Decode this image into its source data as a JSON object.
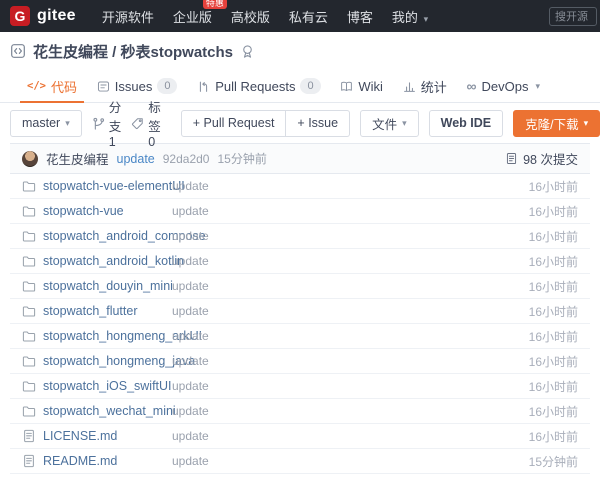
{
  "navbar": {
    "logo_letter": "G",
    "logo_text": "gitee",
    "items": [
      {
        "label": "开源软件"
      },
      {
        "label": "企业版",
        "badge": "特惠"
      },
      {
        "label": "高校版"
      },
      {
        "label": "私有云"
      },
      {
        "label": "博客"
      },
      {
        "label": "我的"
      }
    ],
    "search_placeholder": "搜开源"
  },
  "repo": {
    "title": "花生皮编程 / 秒表stopwatchs"
  },
  "tabs": [
    {
      "label": "代码",
      "active": true
    },
    {
      "label": "Issues",
      "count": "0"
    },
    {
      "label": "Pull Requests",
      "count": "0"
    },
    {
      "label": "Wiki"
    },
    {
      "label": "统计"
    },
    {
      "label": "DevOps"
    }
  ],
  "toolbar": {
    "branch_button": "master",
    "branches_text": "分支 1",
    "tags_text": "标签 0",
    "pull_request_button": "+ Pull Request",
    "issue_button": "+ Issue",
    "files_button": "文件",
    "web_ide_button": "Web IDE",
    "clone_button": "克隆/下载"
  },
  "commit_bar": {
    "author": "花生皮编程",
    "message": "update",
    "hash": "92da2d0",
    "time": "15分钟前",
    "commits_count": "98 次提交"
  },
  "files": [
    {
      "name": "stopwatch-vue-elementUI",
      "type": "folder",
      "message": "update",
      "time": "16小时前"
    },
    {
      "name": "stopwatch-vue",
      "type": "folder",
      "message": "update",
      "time": "16小时前"
    },
    {
      "name": "stopwatch_android_compose",
      "type": "folder",
      "message": "update",
      "time": "16小时前"
    },
    {
      "name": "stopwatch_android_kotlin",
      "type": "folder",
      "message": "update",
      "time": "16小时前"
    },
    {
      "name": "stopwatch_douyin_mini",
      "type": "folder",
      "message": "update",
      "time": "16小时前"
    },
    {
      "name": "stopwatch_flutter",
      "type": "folder",
      "message": "update",
      "time": "16小时前"
    },
    {
      "name": "stopwatch_hongmeng_arkUI",
      "type": "folder",
      "message": "update",
      "time": "16小时前"
    },
    {
      "name": "stopwatch_hongmeng_java",
      "type": "folder",
      "message": "update",
      "time": "16小时前"
    },
    {
      "name": "stopwatch_iOS_swiftUI",
      "type": "folder",
      "message": "update",
      "time": "16小时前"
    },
    {
      "name": "stopwatch_wechat_mini",
      "type": "folder",
      "message": "update",
      "time": "16小时前"
    },
    {
      "name": "LICENSE.md",
      "type": "file",
      "message": "update",
      "time": "16小时前"
    },
    {
      "name": "README.md",
      "type": "file",
      "message": "update",
      "time": "15分钟前"
    }
  ],
  "colors": {
    "navbar_bg": "#23272e",
    "brand_red": "#c71d23",
    "badge_red": "#e6413c",
    "accent_orange": "#ec7232",
    "link_blue": "#4a87c6",
    "file_link_blue": "#4c719c"
  }
}
